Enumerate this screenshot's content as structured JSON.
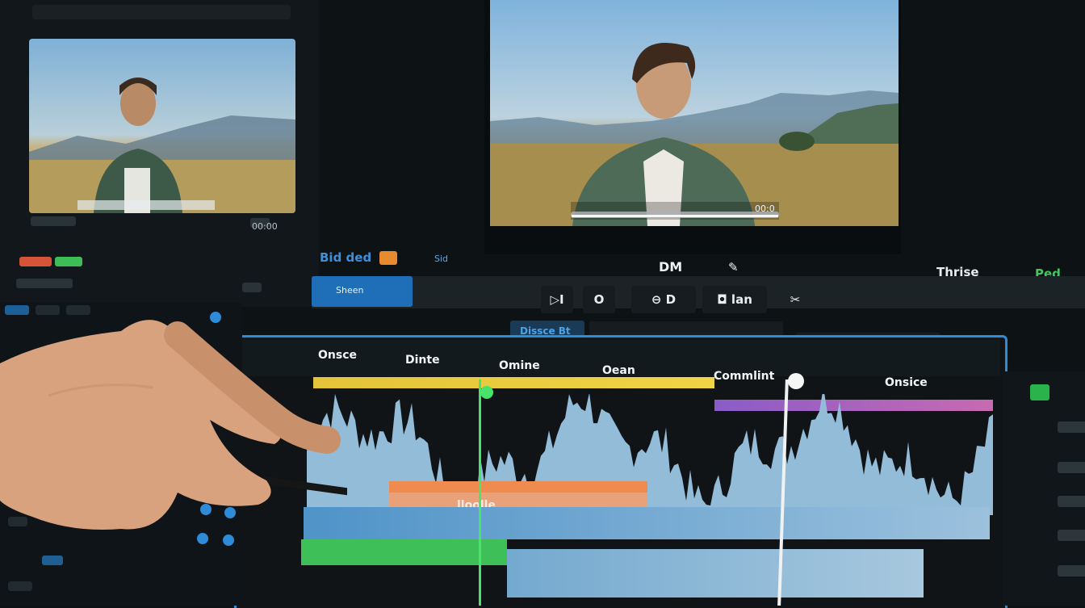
{
  "toolbar": {
    "left_label": "Bid ded",
    "left_tag": "Sid",
    "title": "DM",
    "title_icon": "✎",
    "right_label": "Thrise",
    "right_tag": "Ped",
    "section_label": "Sheen",
    "buttons": {
      "play_label": "▷I",
      "record_label": "O",
      "loop_label": "⊖ D",
      "stop_label": "◘ lan",
      "scissors_label": "✂"
    },
    "timeline_toggle": "Dissce Bt"
  },
  "timeline": {
    "markers": [
      "Onsce",
      "Dinte",
      "Omine",
      "Oean",
      "Commlint",
      "Onsice"
    ],
    "clip_label": "lloolle"
  },
  "preview": {
    "left_time": "00:00",
    "main_time": "00:0"
  },
  "colors": {
    "accent": "#2d8bd8",
    "playhead_green": "#48e36a",
    "clip_orange": "#f08b4f",
    "clip_blue": "#4f93c8",
    "clip_green": "#3fbf58",
    "ruler_yellow": "#e3c43a",
    "ruler_purple": "#8a5cc8"
  },
  "icons": [
    "play-icon",
    "record-icon",
    "loop-icon",
    "stop-icon",
    "scissors-icon",
    "pencil-icon"
  ]
}
